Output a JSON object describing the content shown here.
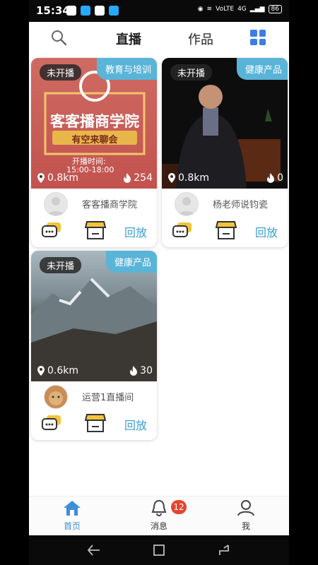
{
  "status_bar": {
    "time": "15:34",
    "battery": "86",
    "net_label": "VoLTE",
    "signal_label": "4G"
  },
  "top_nav": {
    "tabs": [
      "直播",
      "作品"
    ]
  },
  "cards": [
    {
      "status": "未开播",
      "category": "教育与培训",
      "distance": "0.8km",
      "heat": "254",
      "host_name": "客客播商学院",
      "replay_label": "回放",
      "poster": {
        "title": "客客播商学院",
        "subtitle": "有空来聊会",
        "time_label": "开播时间:",
        "time_range": "15:00-18:00"
      }
    },
    {
      "status": "未开播",
      "category": "健康产品",
      "distance": "0.8km",
      "heat": "0",
      "host_name": "杨老师说钧瓷",
      "replay_label": "回放"
    },
    {
      "status": "未开播",
      "category": "健康产品",
      "distance": "0.6km",
      "heat": "30",
      "host_name": "运营1直播间",
      "replay_label": "回放"
    }
  ],
  "tab_bar": {
    "items": [
      {
        "label": "首页",
        "icon": "home-icon"
      },
      {
        "label": "消息",
        "icon": "bell-icon"
      },
      {
        "label": "我",
        "icon": "user-icon"
      }
    ],
    "message_badge": "12"
  },
  "colors": {
    "accent": "#3c8fd6",
    "category_badge": "#5ab4d8",
    "notification": "#e5452f"
  }
}
